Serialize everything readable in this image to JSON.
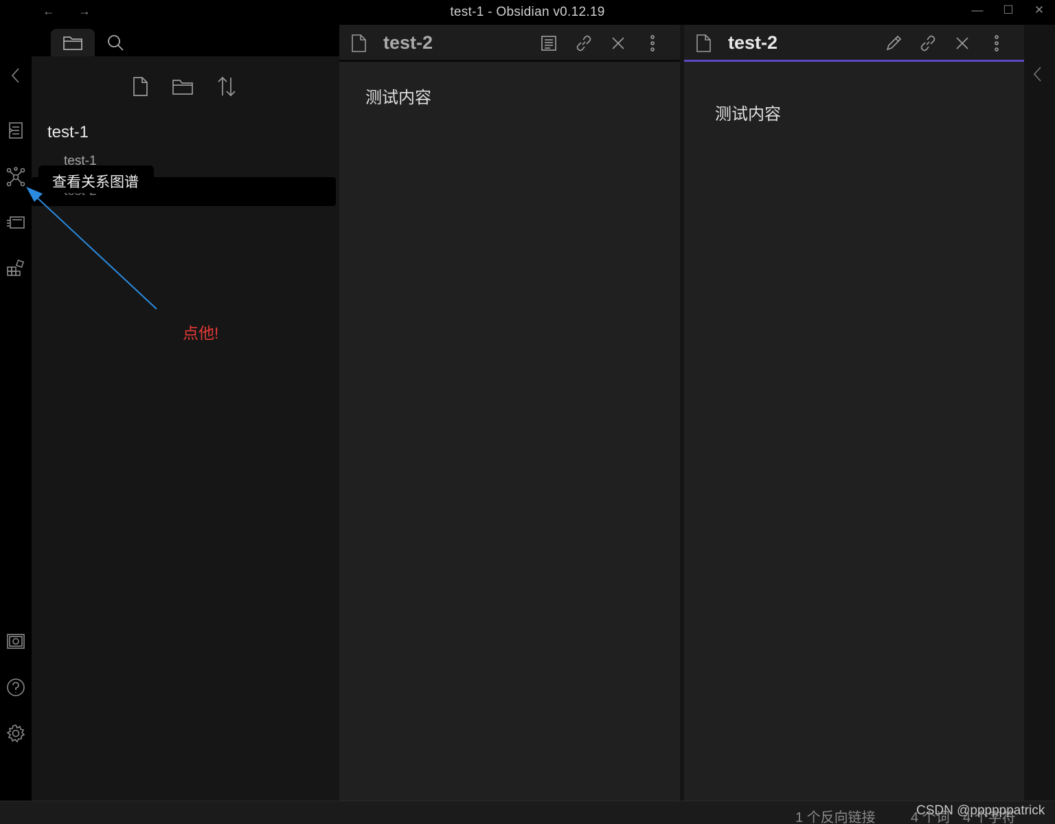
{
  "window": {
    "title": "test-1 - Obsidian v0.12.19",
    "back_glyph": "←",
    "forward_glyph": "→",
    "minimize_glyph": "—",
    "maximize_glyph": "☐",
    "close_glyph": "✕"
  },
  "ribbon": {
    "collapse_glyph": "‹",
    "items": [
      "open-quick-switcher",
      "graph-view",
      "slides",
      "plugins"
    ],
    "bottom_items": [
      "vault-switcher",
      "help",
      "settings"
    ]
  },
  "left_panel": {
    "tabs": [
      "file-explorer",
      "search"
    ],
    "actions": [
      "new-note",
      "new-folder",
      "change-sort-order"
    ],
    "vault_name": "test-1",
    "files": [
      {
        "name": "test-1"
      },
      {
        "name": "test-2"
      }
    ]
  },
  "tooltip": {
    "text": "查看关系图谱"
  },
  "annotation": {
    "text": "点他!",
    "color": "#e53935",
    "arrow_color": "#2b8be0"
  },
  "panes": [
    {
      "title": "test-2",
      "mode_button": "preview-toggle",
      "content": "测试内容",
      "active": false
    },
    {
      "title": "test-2",
      "mode_button": "edit-toggle",
      "content": "测试内容",
      "active": true
    }
  ],
  "right_strip": {
    "collapse_glyph": "‹"
  },
  "status_bar": {
    "backlinks": "1 个反向链接",
    "words": "4 个词",
    "chars": "4 个字符",
    "watermark": "CSDN @ppppppatrick"
  },
  "colors": {
    "accent": "#5e47c4",
    "background": "#202020",
    "sidebar": "#161616"
  }
}
